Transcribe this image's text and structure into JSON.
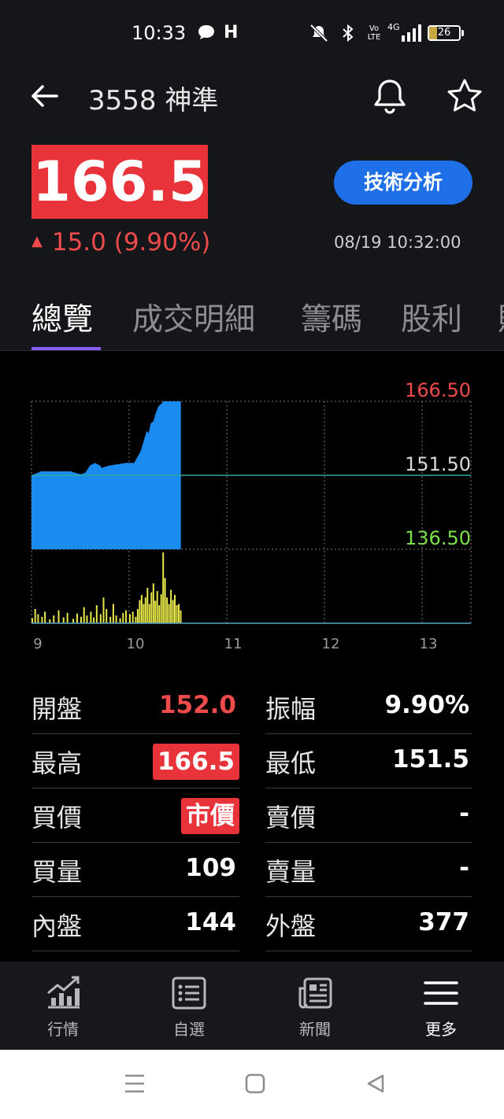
{
  "status_bar": {
    "time": "10:33",
    "battery": "26",
    "network": "4G",
    "volte": "Vo LTE"
  },
  "header": {
    "title": "3558 神準"
  },
  "quote_header": {
    "price": "166.5",
    "change": "15.0 (9.90%)",
    "change_arrow": "▲",
    "tech_button": "技術分析",
    "timestamp": "08/19 10:32:00"
  },
  "tabs": [
    "總覽",
    "成交明細",
    "籌碼",
    "股利",
    "財"
  ],
  "active_tab": 0,
  "chart_data": {
    "type": "area",
    "price_labels": {
      "high": "166.50",
      "ref": "151.50",
      "low": "136.50"
    },
    "ylim": [
      136.5,
      166.5
    ],
    "reference": 151.5,
    "x_ticks": [
      "9",
      "10",
      "11",
      "12",
      "13"
    ],
    "price_series": {
      "x_hours": [
        9.0,
        9.1,
        9.4,
        9.45,
        9.5,
        9.55,
        9.6,
        9.65,
        9.7,
        9.72,
        9.8,
        9.9,
        9.97,
        10.0,
        10.05,
        10.08,
        10.12,
        10.15,
        10.18,
        10.2,
        10.22,
        10.25,
        10.27,
        10.3,
        10.33,
        10.35,
        10.4,
        10.45,
        10.53
      ],
      "values": [
        151.5,
        152.3,
        152.3,
        152.0,
        151.7,
        152.0,
        153.5,
        154.0,
        153.5,
        153.0,
        153.5,
        153.8,
        154.0,
        154.0,
        154.0,
        155.0,
        156.5,
        158.5,
        160.5,
        160.0,
        162.0,
        162.5,
        164.0,
        165.5,
        166.0,
        166.5,
        166.5,
        166.5,
        166.5
      ]
    },
    "volume_series": {
      "x_hours": [
        9.0,
        9.03,
        9.06,
        9.1,
        9.13,
        9.18,
        9.22,
        9.27,
        9.32,
        9.36,
        9.42,
        9.46,
        9.5,
        9.53,
        9.56,
        9.6,
        9.63,
        9.66,
        9.7,
        9.73,
        9.76,
        9.8,
        9.83,
        9.86,
        9.9,
        9.93,
        9.96,
        10.0,
        10.03,
        10.06,
        10.08,
        10.1,
        10.12,
        10.14,
        10.16,
        10.18,
        10.2,
        10.22,
        10.24,
        10.26,
        10.28,
        10.3,
        10.32,
        10.34,
        10.36,
        10.38,
        10.4,
        10.42,
        10.44,
        10.46,
        10.48,
        10.5,
        10.52
      ],
      "values": [
        8,
        22,
        14,
        10,
        18,
        6,
        12,
        20,
        9,
        16,
        7,
        15,
        10,
        25,
        12,
        18,
        9,
        28,
        14,
        40,
        22,
        10,
        30,
        12,
        8,
        16,
        20,
        14,
        18,
        10,
        22,
        36,
        44,
        30,
        40,
        55,
        30,
        48,
        62,
        35,
        50,
        28,
        45,
        110,
        70,
        40,
        30,
        52,
        36,
        44,
        28,
        30,
        20
      ]
    }
  },
  "quote_table": {
    "rows": [
      {
        "l_label": "開盤",
        "l_value": "152.0",
        "r_label": "振幅",
        "r_value": "9.90%"
      },
      {
        "l_label": "最高",
        "l_value": "166.5",
        "r_label": "最低",
        "r_value": "151.5"
      },
      {
        "l_label": "買價",
        "l_value": "市價",
        "r_label": "賣價",
        "r_value": "-"
      },
      {
        "l_label": "買量",
        "l_value": "109",
        "r_label": "賣量",
        "r_value": "-"
      },
      {
        "l_label": "內盤",
        "l_value": "144",
        "r_label": "外盤",
        "r_value": "377"
      }
    ]
  },
  "bottom_nav": [
    {
      "label": "行情",
      "icon": "chart-growth-icon"
    },
    {
      "label": "自選",
      "icon": "watchlist-icon"
    },
    {
      "label": "新聞",
      "icon": "news-icon"
    },
    {
      "label": "更多",
      "icon": "menu-icon"
    }
  ],
  "colors": {
    "up_red": "#e8333a",
    "down_green": "#7be04a",
    "area_blue": "#1a8cf0",
    "volume_yellow": "#e8e84a",
    "accent_purple": "#8a5cf6",
    "button_blue": "#1f6fe8"
  }
}
